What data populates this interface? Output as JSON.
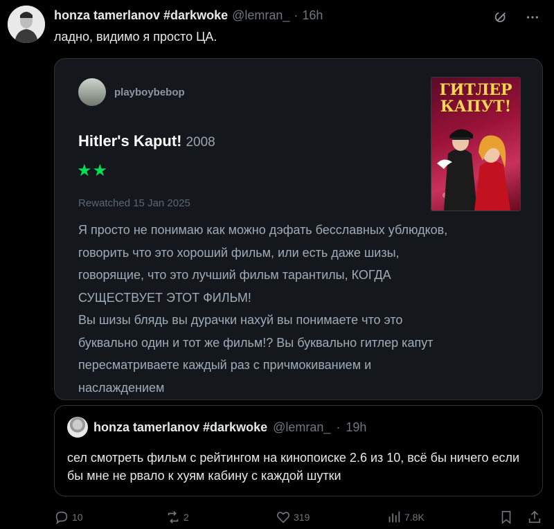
{
  "tweet": {
    "author_name": "honza tamerlanov #darkwoke",
    "handle": "@lemran_",
    "separator": "·",
    "time": "16h",
    "text": "ладно, видимо я просто ЦА."
  },
  "review": {
    "username": "playboybebop",
    "film_title": "Hitler's Kaput!",
    "film_year": "2008",
    "stars": "★★",
    "rewatched": "Rewatched 15 Jan 2025",
    "body": "Я просто не понимаю как можно дэфать бесславных ублюдков,\nговорить что это хороший фильм, или есть даже шизы,\nговорящие, что это лучший фильм тарантилы, КОГДА\nСУЩЕСТВУЕТ ЭТОТ ФИЛЬМ!\nВы шизы блядь вы дурачки нахуй вы понимаете что это\nбуквально один и тот же фильм!? Вы буквально гитлер капут\nпересматриваете каждый раз с причмокиванием и\nнаслаждением",
    "poster_title": "ГИТЛЕР КАПУТ!",
    "star_color": "#00e054"
  },
  "quote": {
    "author_name": "honza tamerlanov #darkwoke",
    "handle": "@lemran_",
    "separator": "·",
    "time": "19h",
    "text": "сел смотреть фильм с рейтингом на кинопоиске 2.6 из 10, всё бы ничего если бы мне не рвало к хуям кабину с каждой шутки"
  },
  "actions": {
    "replies": "10",
    "reposts": "2",
    "likes": "319",
    "views": "7.8K"
  },
  "icons": [
    "grok-icon",
    "more-icon",
    "reply-icon",
    "repost-icon",
    "like-icon",
    "views-icon",
    "bookmark-icon",
    "share-icon"
  ]
}
